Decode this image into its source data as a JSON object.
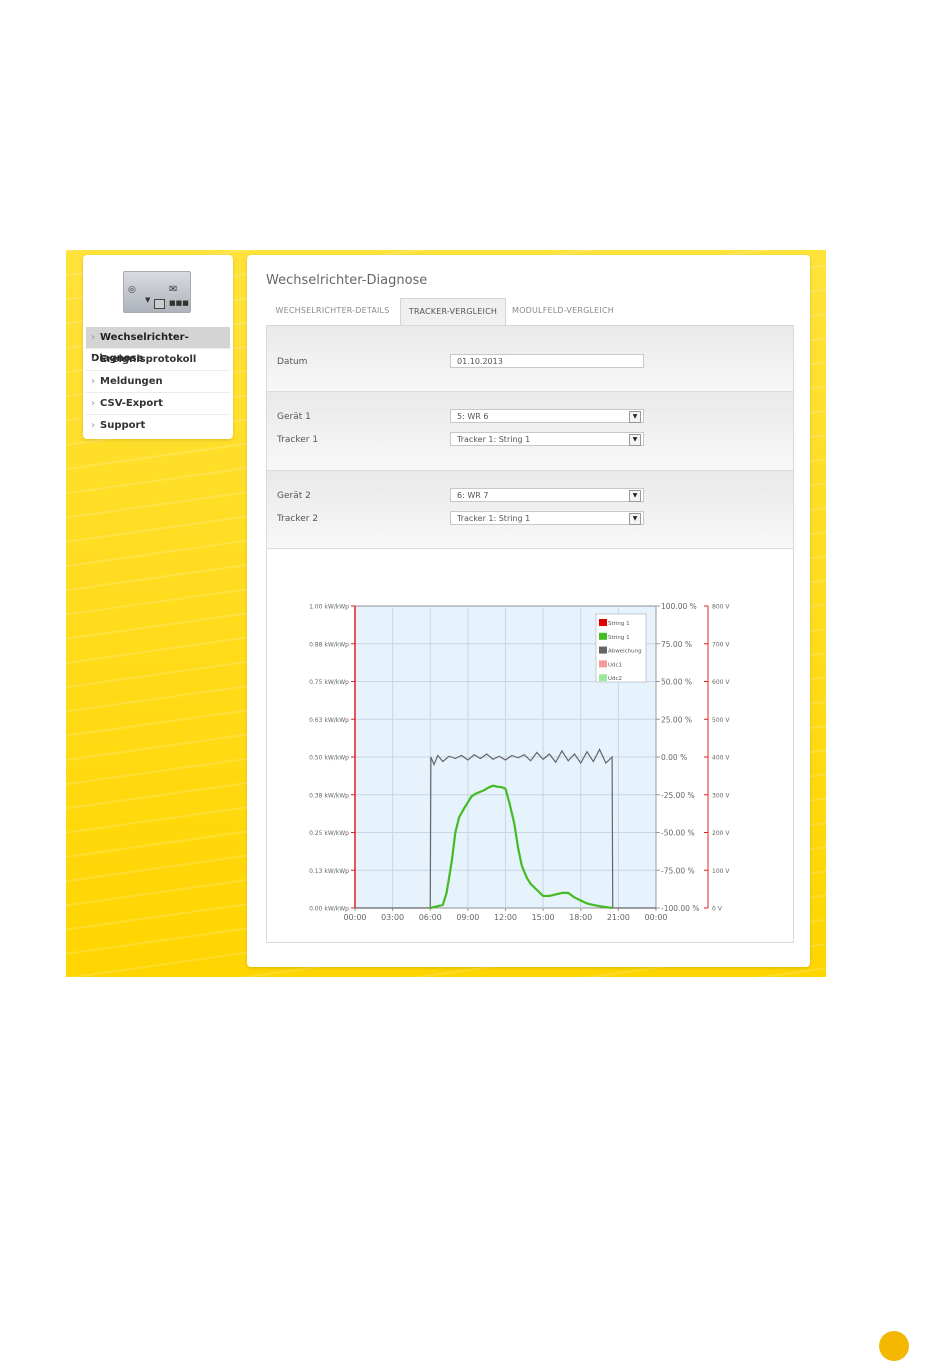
{
  "sidebar": {
    "items": [
      {
        "label": "Wechselrichter-Diagnose",
        "active": true
      },
      {
        "label": "Ereignisprotokoll",
        "active": false
      },
      {
        "label": "Meldungen",
        "active": false
      },
      {
        "label": "CSV-Export",
        "active": false
      },
      {
        "label": "Support",
        "active": false
      }
    ],
    "logo_icons": [
      "globe-icon",
      "mail-icon",
      "wifi-icon",
      "display-icon",
      "battery-icon"
    ]
  },
  "page": {
    "title": "Wechselrichter-Diagnose",
    "tabs": [
      {
        "label": "WECHSELRICHTER-DETAILS",
        "active": false
      },
      {
        "label": "TRACKER-VERGLEICH",
        "active": true
      },
      {
        "label": "MODULFELD-VERGLEICH",
        "active": false
      }
    ]
  },
  "form": {
    "datum_label": "Datum",
    "datum_value": "01.10.2013",
    "geraet1_label": "Gerät 1",
    "geraet1_value": "5: WR 6",
    "tracker1_label": "Tracker 1",
    "tracker1_value": "Tracker 1: String 1",
    "geraet2_label": "Gerät 2",
    "geraet2_value": "6: WR 7",
    "tracker2_label": "Tracker 2",
    "tracker2_value": "Tracker 1: String 1"
  },
  "colors": {
    "accent_yellow": "#ffd800",
    "page_badge": "#f5b800",
    "plot_bg": "#e6f2fc",
    "axis_red": "#e02020",
    "series_string1": "#e00000",
    "series_string1b": "#44bb22",
    "series_abweichung": "#666666",
    "series_udc1": "#f39a9a",
    "series_udc2": "#9ee89e"
  },
  "chart_data": {
    "type": "line",
    "x_ticks": [
      "00:00",
      "03:00",
      "06:00",
      "09:00",
      "12:00",
      "15:00",
      "18:00",
      "21:00",
      "00:00"
    ],
    "xlim": [
      0,
      24
    ],
    "left_axis": {
      "ticks": [
        "1.00 kW/kWp",
        "0.88 kW/kWp",
        "0.75 kW/kWp",
        "0.63 kW/kWp",
        "0.50 kW/kWp",
        "0.38 kW/kWp",
        "0.25 kW/kWp",
        "0.13 kW/kWp",
        "0.00 kW/kWp"
      ],
      "ylim": [
        0,
        1.0
      ]
    },
    "right_axis_pct": {
      "ticks": [
        "100.00 %",
        "75.00 %",
        "50.00 %",
        "25.00 %",
        "0.00 %",
        "-25.00 %",
        "-50.00 %",
        "-75.00 %",
        "-100.00 %"
      ],
      "ylim": [
        -100,
        100
      ]
    },
    "right_axis_volt": {
      "ticks": [
        "800 V",
        "700 V",
        "600 V",
        "500 V",
        "400 V",
        "300 V",
        "200 V",
        "100 V",
        "0 V"
      ],
      "ylim": [
        0,
        800
      ]
    },
    "legend": {
      "placement": "top-right",
      "entries": [
        "String 1",
        "String 1",
        "Abweichung",
        "Udc1",
        "Udc2"
      ]
    },
    "series": [
      {
        "name": "String 1",
        "axis": "left",
        "x": [
          6.0,
          7.0,
          7.3,
          7.7,
          8.0,
          8.3,
          8.7,
          9.0,
          9.3,
          9.7,
          10.0,
          10.3,
          10.7,
          11.0,
          11.3,
          11.7,
          12.0,
          12.3,
          12.7,
          13.0,
          13.3,
          13.7,
          14.0,
          14.5,
          15.0,
          15.5,
          16.0,
          16.5,
          17.0,
          17.5,
          18.0,
          18.5,
          19.0,
          19.5,
          20.0,
          20.5
        ],
        "y": [
          0.0,
          0.01,
          0.05,
          0.15,
          0.25,
          0.3,
          0.33,
          0.35,
          0.37,
          0.38,
          0.385,
          0.39,
          0.4,
          0.405,
          0.402,
          0.4,
          0.395,
          0.35,
          0.28,
          0.2,
          0.14,
          0.1,
          0.08,
          0.06,
          0.04,
          0.04,
          0.045,
          0.05,
          0.05,
          0.035,
          0.025,
          0.015,
          0.01,
          0.006,
          0.003,
          0.0
        ]
      },
      {
        "name": "Abweichung",
        "axis": "pct",
        "x": [
          0,
          6.0,
          6.05,
          6.3,
          6.6,
          7.0,
          7.5,
          8.0,
          8.5,
          9.0,
          9.5,
          10.0,
          10.5,
          11.0,
          11.5,
          12.0,
          12.5,
          13.0,
          13.5,
          14.0,
          14.5,
          15.0,
          15.5,
          16.0,
          16.5,
          17.0,
          17.5,
          18.0,
          18.5,
          19.0,
          19.5,
          20.0,
          20.5,
          20.55,
          24
        ],
        "y": [
          -100,
          -100,
          0.0,
          -5.0,
          1.0,
          -3.0,
          0.5,
          -1.0,
          1.0,
          -2.0,
          1.5,
          -1.0,
          2.0,
          -1.5,
          0.5,
          -2.0,
          1.0,
          -0.5,
          1.5,
          -2.5,
          3.0,
          -1.5,
          2.0,
          -3.5,
          4.0,
          -2.5,
          2.0,
          -4.0,
          3.5,
          -3.0,
          5.0,
          -4.0,
          0.0,
          -100,
          -100
        ]
      }
    ]
  }
}
